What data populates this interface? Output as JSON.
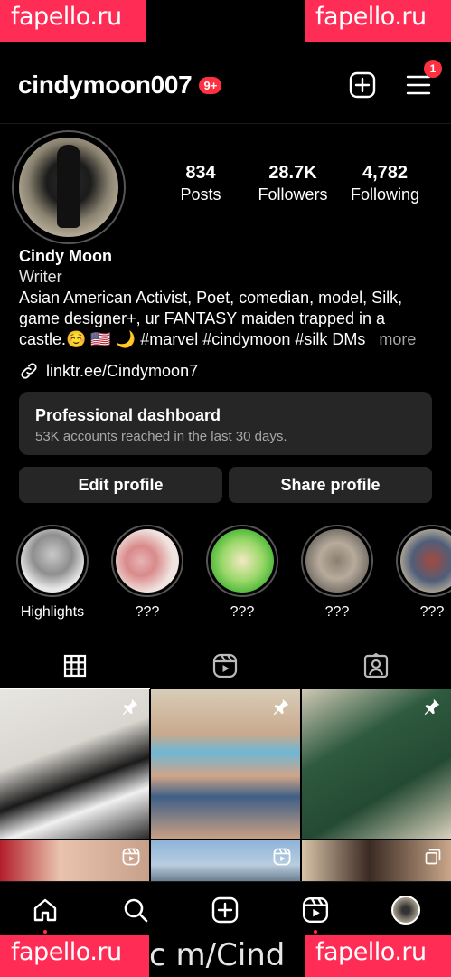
{
  "watermark": {
    "text": "fapello.ru",
    "url_fragment": "c m/Cind"
  },
  "header": {
    "username": "cindymoon007",
    "notification_badge": "9+",
    "menu_badge": "1"
  },
  "stats": [
    {
      "value": "834",
      "label": "Posts"
    },
    {
      "value": "28.7K",
      "label": "Followers"
    },
    {
      "value": "4,782",
      "label": "Following"
    }
  ],
  "bio": {
    "name": "Cindy Moon",
    "category": "Writer",
    "line1": "Asian American Activist, Poet, comedian, model, Silk,",
    "line2": "game designer+, ur FANTASY maiden trapped in a",
    "line3": "castle.☺️ 🇺🇸 🌙 #marvel #cindymoon #silk DMs",
    "more": "more",
    "link": "linktr.ee/Cindymoon7"
  },
  "dashboard": {
    "title": "Professional dashboard",
    "subtitle": "53K accounts reached in the last 30 days."
  },
  "buttons": {
    "edit": "Edit profile",
    "share": "Share profile"
  },
  "highlights": [
    {
      "label": "Highlights"
    },
    {
      "label": "???"
    },
    {
      "label": "???"
    },
    {
      "label": "???"
    },
    {
      "label": "???"
    }
  ],
  "colors": {
    "accent": "#ff3040",
    "watermark": "#ff2d55",
    "surface": "#262626",
    "muted": "#a8a8a8"
  }
}
